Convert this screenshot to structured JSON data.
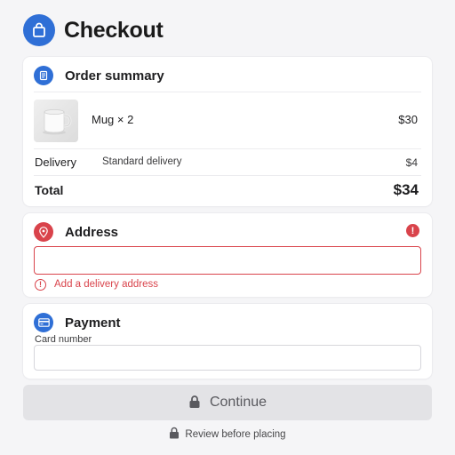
{
  "header": {
    "title": "Checkout",
    "icon": "shopping-bag-icon"
  },
  "order_summary": {
    "title": "Order summary",
    "icon": "receipt-icon",
    "item": {
      "name": "Mug × 2",
      "price": "$30",
      "image": "mug"
    },
    "delivery": {
      "label": "Delivery",
      "method": "Standard delivery",
      "price": "$4"
    },
    "total": {
      "label": "Total",
      "value": "$34"
    }
  },
  "address": {
    "title": "Address",
    "icon": "location-pin-icon",
    "status": "error",
    "value": "",
    "error_text": "Add a delivery address"
  },
  "payment": {
    "title": "Payment",
    "icon": "credit-card-icon",
    "card_label": "Card number",
    "card_value": ""
  },
  "actions": {
    "continue_label": "Continue",
    "continue_enabled": false,
    "review_note": "Review before placing"
  },
  "colors": {
    "accent": "#2f6fd6",
    "error": "#d9434b",
    "background": "#f5f5f7",
    "disabled_button": "#e3e3e6"
  }
}
